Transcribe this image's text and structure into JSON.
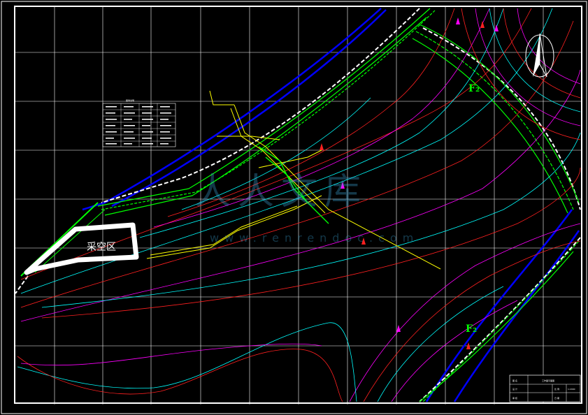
{
  "labels": {
    "goaf": "采空区",
    "fault_f2_upper": "F₂",
    "fault_f2_lower": "F₂"
  },
  "watermark": {
    "chars": "人人文库",
    "url": "www.renrendoc.com"
  },
  "legend_title": "图例说明",
  "title_block": {
    "drawing_title": "工作面平面图",
    "row1_label": "图 名",
    "row2_label": "设 计",
    "row2_value": "比 例",
    "row3_label": "审 核",
    "row3_value": "日 期",
    "scale": "1:2000"
  },
  "colors": {
    "background": "#000000",
    "grid": "#ffffff",
    "roadway": "#ffff00",
    "seam_boundary": "#0000ff",
    "fault": "#00ff00",
    "contour_red": "#ff2020",
    "contour_cyan": "#00ffff",
    "contour_magenta": "#ff00ff"
  }
}
